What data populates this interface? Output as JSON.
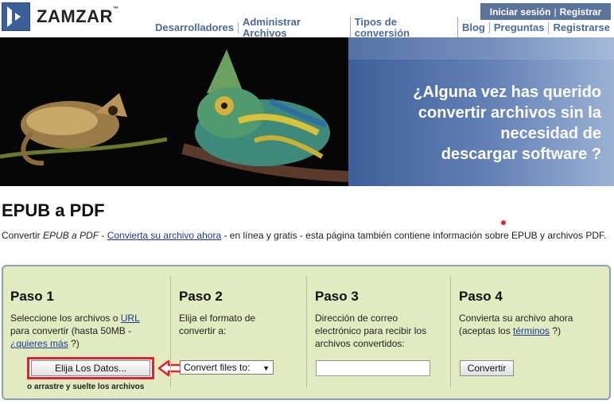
{
  "header": {
    "logo_text": "ZAMZAR",
    "logo_tm": "™",
    "auth": {
      "login": "Iniciar sesión",
      "separator": "|",
      "register": "Registrar"
    },
    "nav": [
      "Desarrolladores",
      "Administrar Archivos",
      "Tipos de conversión",
      "Blog",
      "Preguntas",
      "Registrarse"
    ]
  },
  "banner": {
    "lines": [
      "¿Alguna vez has querido",
      "convertir archivos sin la",
      "necesidad de",
      "descargar software ?"
    ],
    "colors": {
      "panel_left": "#3d5f9a",
      "panel_right": "#9bb2d4"
    }
  },
  "page": {
    "title": "EPUB a PDF",
    "desc_prefix": "Convertir ",
    "desc_em": "EPUB a PDF",
    "desc_dash": " - ",
    "desc_link": "Convierta su archivo ahora",
    "desc_rest": " - en línea y gratis - esta página también contiene información sobre EPUB y archivos PDF."
  },
  "steps": {
    "step1": {
      "title": "Paso 1",
      "text_a": "Seleccione los archivos o ",
      "url_link": "URL",
      "text_b": "para convertir (hasta 50MB -",
      "more_link": "¿quieres más",
      "text_c": " ?)",
      "button": "Elija Los Datos...",
      "drag_note": "o arrastre y suelte los archivos"
    },
    "step2": {
      "title": "Paso 2",
      "text_a": "Elija el formato de",
      "text_b": "convertir a:",
      "select_value": "Convert files to:"
    },
    "step3": {
      "title": "Paso 3",
      "text_a": "Dirección de correo",
      "text_b": "electrónico para recibir los",
      "text_c": "archivos convertidos:",
      "email_value": ""
    },
    "step4": {
      "title": "Paso 4",
      "text_a": "Convierta su archivo ahora",
      "text_b": "(aceptas los ",
      "terms_link": "términos",
      "text_c": " ?)",
      "button": "Convertir"
    }
  },
  "colors": {
    "accent_red": "#e0202a",
    "panel_bg": "#e1ebbf",
    "nav_text": "#4b6a9b",
    "auth_bg": "#5b7499"
  }
}
